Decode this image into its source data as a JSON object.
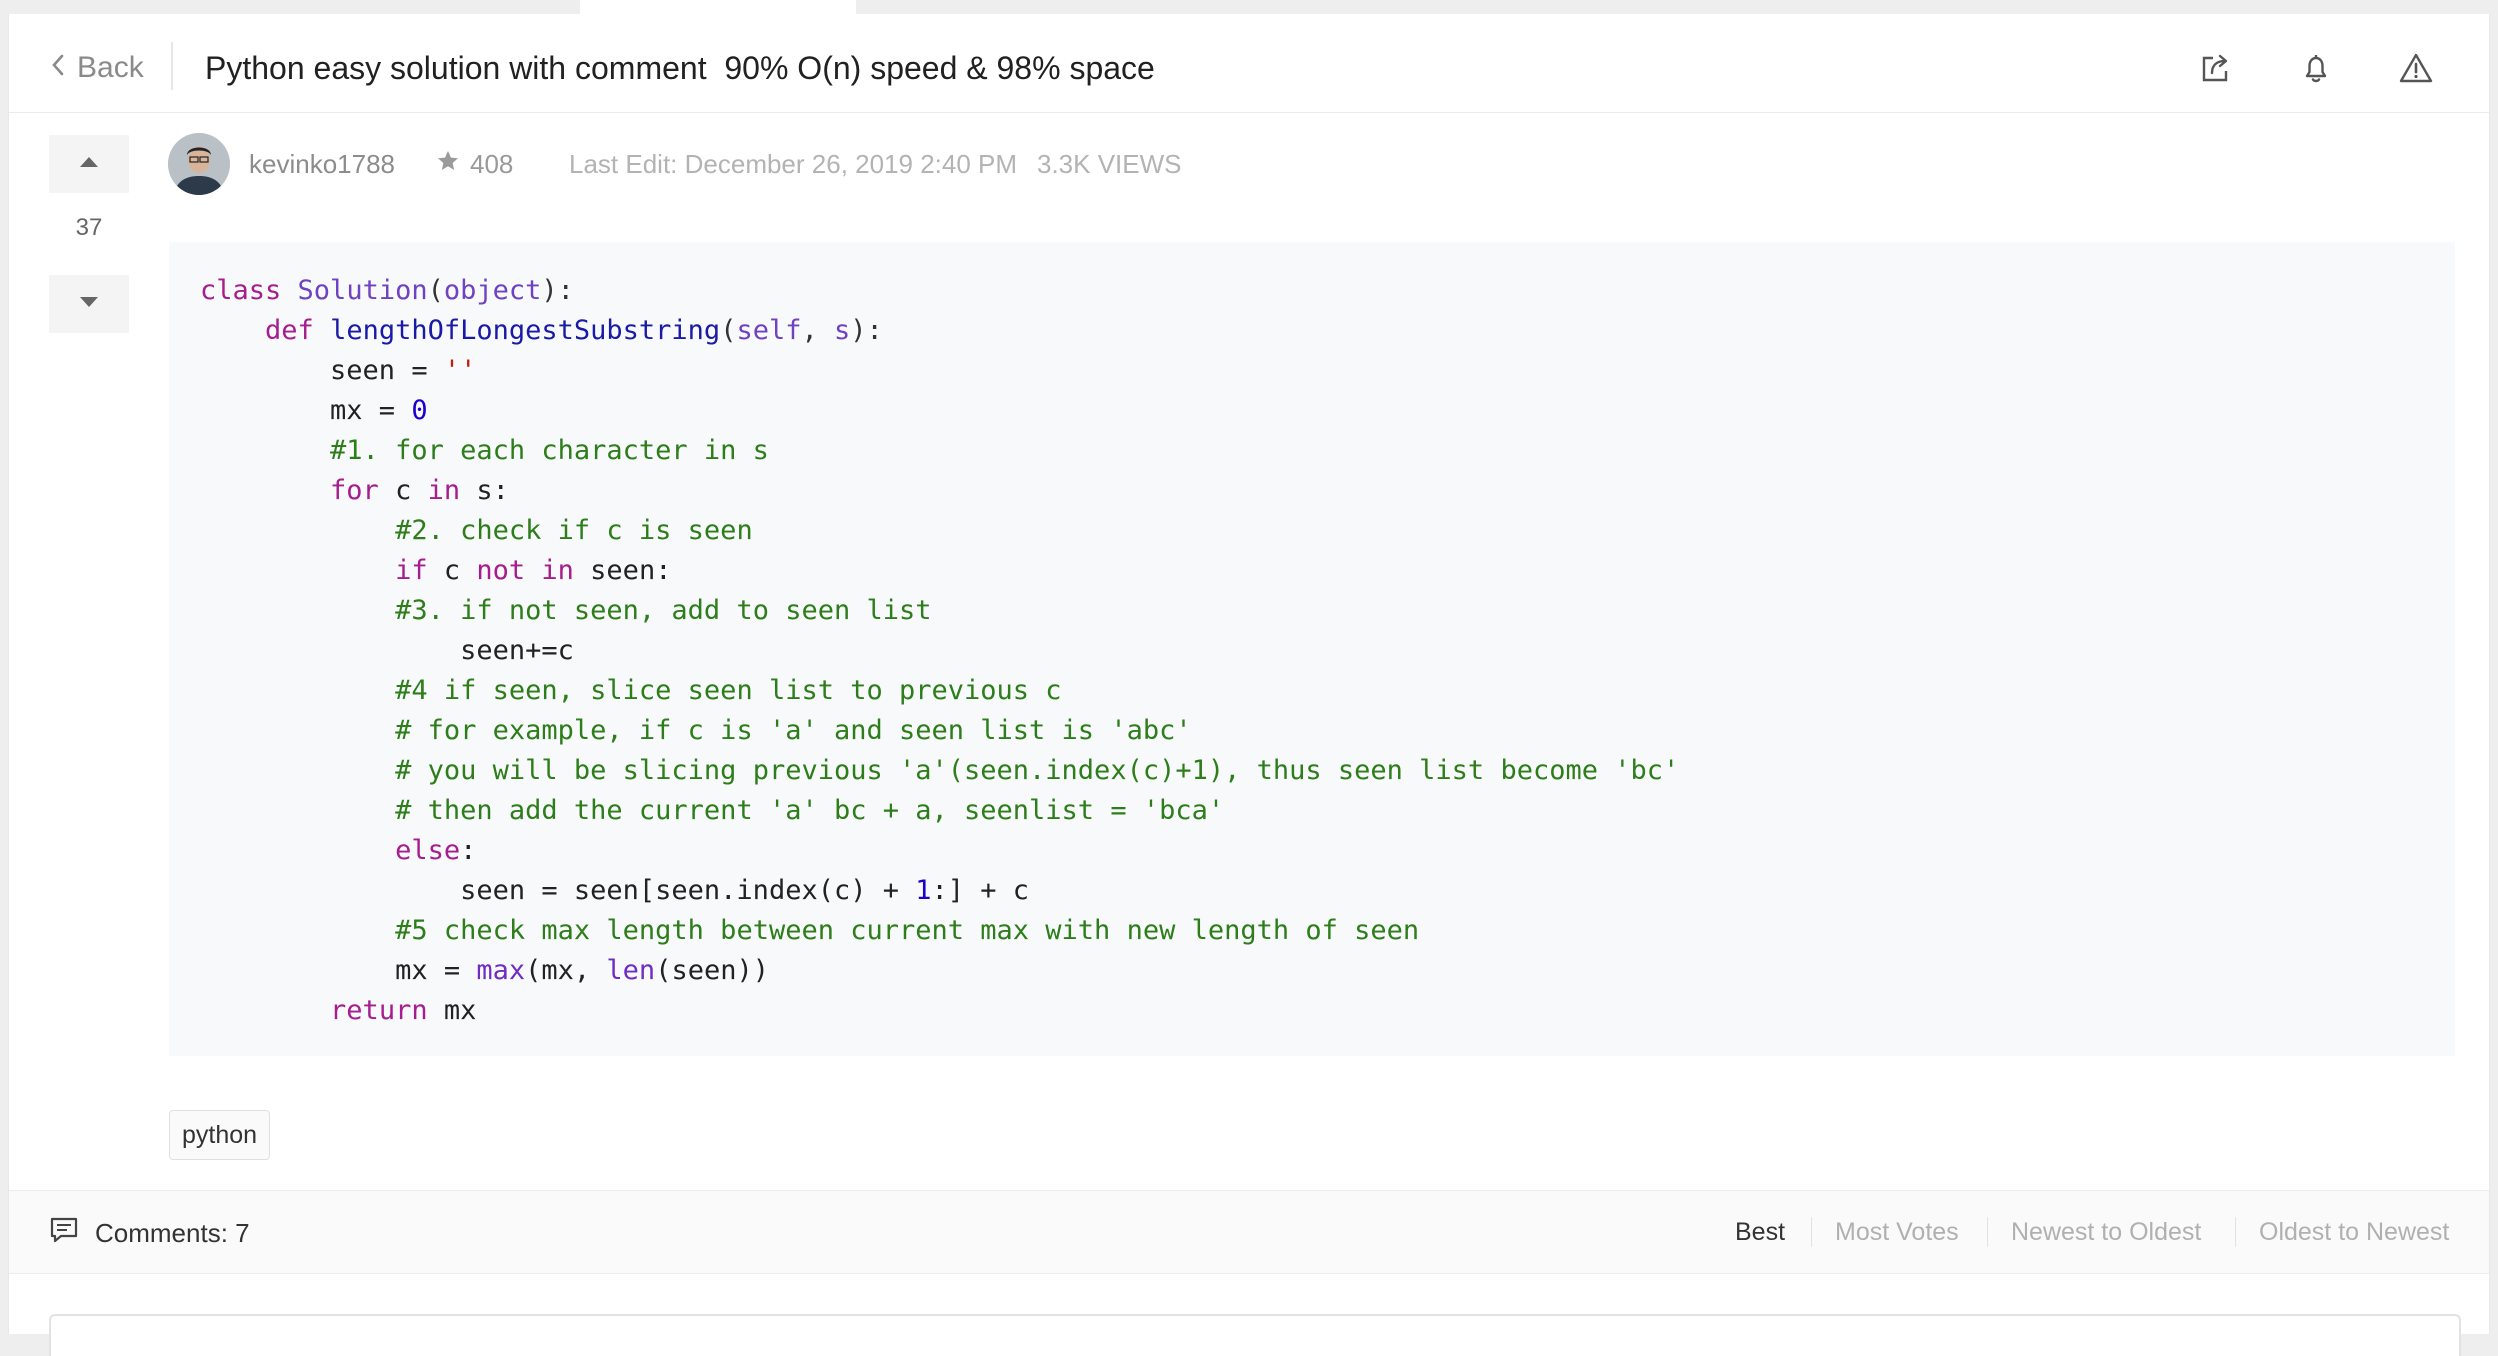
{
  "header": {
    "back_label": "Back",
    "title": "Python easy solution with comment  90% O(n) speed & 98% space",
    "icons": [
      "share-icon",
      "bell-icon",
      "report-warning-icon"
    ]
  },
  "post": {
    "vote_count": "37",
    "author": "kevinko1788",
    "reputation": "408",
    "last_edit": "Last Edit: December 26, 2019 2:40 PM",
    "views": "3.3K VIEWS",
    "code_lines": [
      [
        {
          "t": "class ",
          "c": "kw"
        },
        {
          "t": "Solution",
          "c": "cls"
        },
        {
          "t": "(",
          "c": "pm"
        },
        {
          "t": "object",
          "c": "cls"
        },
        {
          "t": "):",
          "c": "pm"
        }
      ],
      [
        {
          "t": "    "
        },
        {
          "t": "def ",
          "c": "kw"
        },
        {
          "t": "lengthOfLongestSubstring",
          "c": "fn"
        },
        {
          "t": "(",
          "c": "pm"
        },
        {
          "t": "self",
          "c": "cls"
        },
        {
          "t": ", ",
          "c": "pm"
        },
        {
          "t": "s",
          "c": "cls"
        },
        {
          "t": "):",
          "c": "pm"
        }
      ],
      [
        {
          "t": "        seen = "
        },
        {
          "t": "''",
          "c": "str"
        }
      ],
      [
        {
          "t": "        mx = "
        },
        {
          "t": "0",
          "c": "num"
        }
      ],
      [
        {
          "t": "        "
        },
        {
          "t": "#1. for each character in s",
          "c": "cm"
        }
      ],
      [
        {
          "t": "        "
        },
        {
          "t": "for ",
          "c": "kw"
        },
        {
          "t": "c "
        },
        {
          "t": "in ",
          "c": "kw"
        },
        {
          "t": "s:"
        }
      ],
      [
        {
          "t": "            "
        },
        {
          "t": "#2. check if c is seen",
          "c": "cm"
        }
      ],
      [
        {
          "t": "            "
        },
        {
          "t": "if ",
          "c": "kw"
        },
        {
          "t": "c "
        },
        {
          "t": "not in ",
          "c": "kw"
        },
        {
          "t": "seen:"
        }
      ],
      [
        {
          "t": "            "
        },
        {
          "t": "#3. if not seen, add to seen list",
          "c": "cm"
        }
      ],
      [
        {
          "t": "                seen+=c"
        }
      ],
      [
        {
          "t": "            "
        },
        {
          "t": "#4 if seen, slice seen list to previous c",
          "c": "cm"
        }
      ],
      [
        {
          "t": "            "
        },
        {
          "t": "# for example, if c is 'a' and seen list is 'abc'",
          "c": "cm"
        }
      ],
      [
        {
          "t": "            "
        },
        {
          "t": "# you will be slicing previous 'a'(seen.index(c)+1), thus seen list become 'bc'",
          "c": "cm"
        }
      ],
      [
        {
          "t": "            "
        },
        {
          "t": "# then add the current 'a' bc + a, seenlist = 'bca'",
          "c": "cm"
        }
      ],
      [
        {
          "t": "            "
        },
        {
          "t": "else",
          "c": "kw"
        },
        {
          "t": ":"
        }
      ],
      [
        {
          "t": "                seen = seen[seen.index(c) + "
        },
        {
          "t": "1",
          "c": "num"
        },
        {
          "t": ":] + c"
        }
      ],
      [
        {
          "t": "            "
        },
        {
          "t": "#5 check max length between current max with new length of seen",
          "c": "cm"
        }
      ],
      [
        {
          "t": "            mx = "
        },
        {
          "t": "max",
          "c": "bi"
        },
        {
          "t": "(mx, "
        },
        {
          "t": "len",
          "c": "bi"
        },
        {
          "t": "(seen))"
        }
      ],
      [
        {
          "t": "        "
        },
        {
          "t": "return ",
          "c": "kw"
        },
        {
          "t": "mx"
        }
      ]
    ],
    "tag": "python"
  },
  "comments": {
    "label": "Comments: 7",
    "sort_options": [
      "Best",
      "Most Votes",
      "Newest to Oldest",
      "Oldest to Newest"
    ],
    "active_sort": "Best"
  }
}
